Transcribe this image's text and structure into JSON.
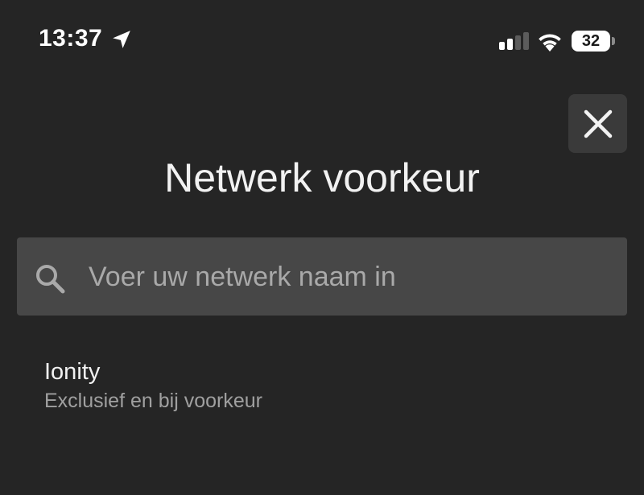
{
  "status_bar": {
    "time": "13:37",
    "battery_level": "32",
    "icons": [
      "location-arrow-icon",
      "cellular-signal-icon",
      "wifi-icon",
      "battery-icon"
    ]
  },
  "header": {
    "title": "Netwerk voorkeur",
    "close_icon": "close-icon"
  },
  "search": {
    "placeholder": "Voer uw netwerk naam in",
    "value": "",
    "icon": "search-icon"
  },
  "networks": [
    {
      "name": "Ionity",
      "description": "Exclusief en bij voorkeur"
    }
  ],
  "colors": {
    "background": "#252525",
    "surface": "#474747",
    "close_button_bg": "#3a3a3a",
    "text_primary": "#f2f2f2",
    "text_secondary": "#a0a0a0"
  }
}
